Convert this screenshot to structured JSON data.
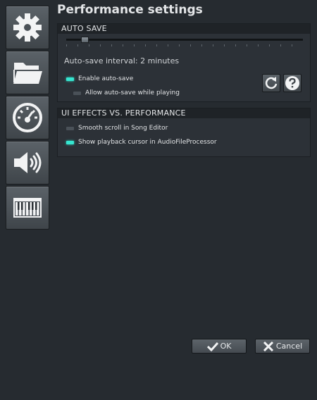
{
  "page": {
    "title": "Performance settings"
  },
  "sidebar": {
    "items": [
      {
        "name": "general",
        "icon": "gear-icon"
      },
      {
        "name": "paths",
        "icon": "folder-icon"
      },
      {
        "name": "performance",
        "icon": "gauge-icon"
      },
      {
        "name": "audio",
        "icon": "speaker-icon"
      },
      {
        "name": "midi",
        "icon": "keyboard-icon"
      }
    ]
  },
  "autosave": {
    "header": "AUTO SAVE",
    "slider_value_minutes": 2,
    "interval_label": "Auto-save interval: 2 minutes",
    "enable_label": "Enable auto-save",
    "enable_checked": true,
    "allow_label": "Allow auto-save while playing",
    "allow_checked": false,
    "reset_icon": "reset-icon",
    "help_icon": "help-icon"
  },
  "ui_effects": {
    "header": "UI EFFECTS VS. PERFORMANCE",
    "smooth_label": "Smooth scroll in Song Editor",
    "smooth_checked": false,
    "cursor_label": "Show playback cursor in AudioFileProcessor",
    "cursor_checked": true
  },
  "dialog": {
    "ok_label": "OK",
    "cancel_label": "Cancel"
  },
  "colors": {
    "background": "#262b30",
    "led_on": "#36e6d0",
    "led_off": "#4a5158"
  }
}
